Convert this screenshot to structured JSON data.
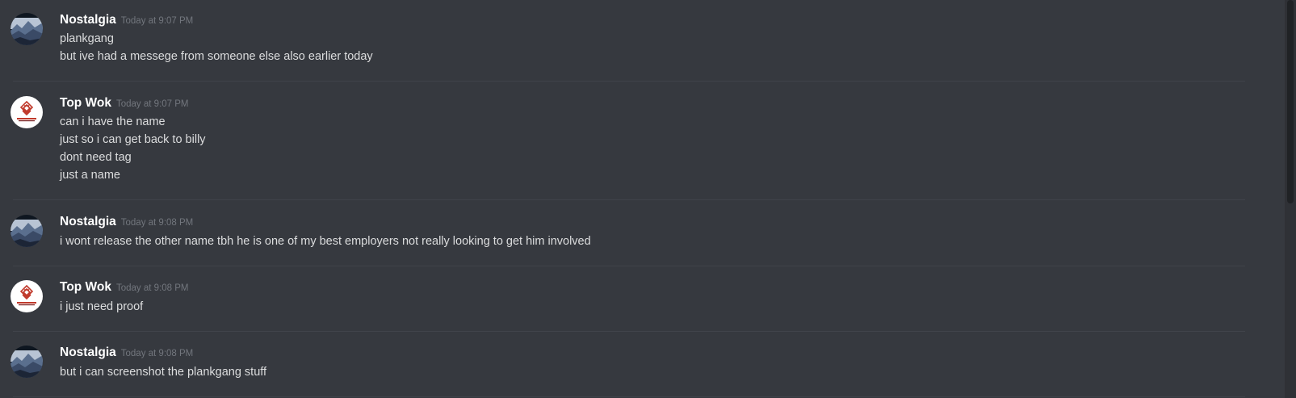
{
  "messages": [
    {
      "username": "Nostalgia",
      "timestamp": "Today at 9:07 PM",
      "avatar": "mountain-landscape",
      "lines": [
        "plankgang",
        "but ive had a messege from someone else also earlier today"
      ]
    },
    {
      "username": "Top Wok",
      "timestamp": "Today at 9:07 PM",
      "avatar": "red-emblem-logo",
      "lines": [
        "can i have the name",
        "just so i can get back to billy",
        "dont need tag",
        "just a name"
      ]
    },
    {
      "username": "Nostalgia",
      "timestamp": "Today at 9:08 PM",
      "avatar": "mountain-landscape",
      "lines": [
        "i wont release the other name tbh he is one of my best employers not really looking to get him involved"
      ]
    },
    {
      "username": "Top Wok",
      "timestamp": "Today at 9:08 PM",
      "avatar": "red-emblem-logo",
      "lines": [
        "i just need proof"
      ]
    },
    {
      "username": "Nostalgia",
      "timestamp": "Today at 9:08 PM",
      "avatar": "mountain-landscape",
      "lines": [
        "but i can screenshot the plankgang stuff"
      ]
    }
  ],
  "colors": {
    "background": "#36393f",
    "username": "#ffffff",
    "timestamp": "#72767d",
    "message_text": "#dcddde",
    "logo_red": "#c0392b"
  }
}
